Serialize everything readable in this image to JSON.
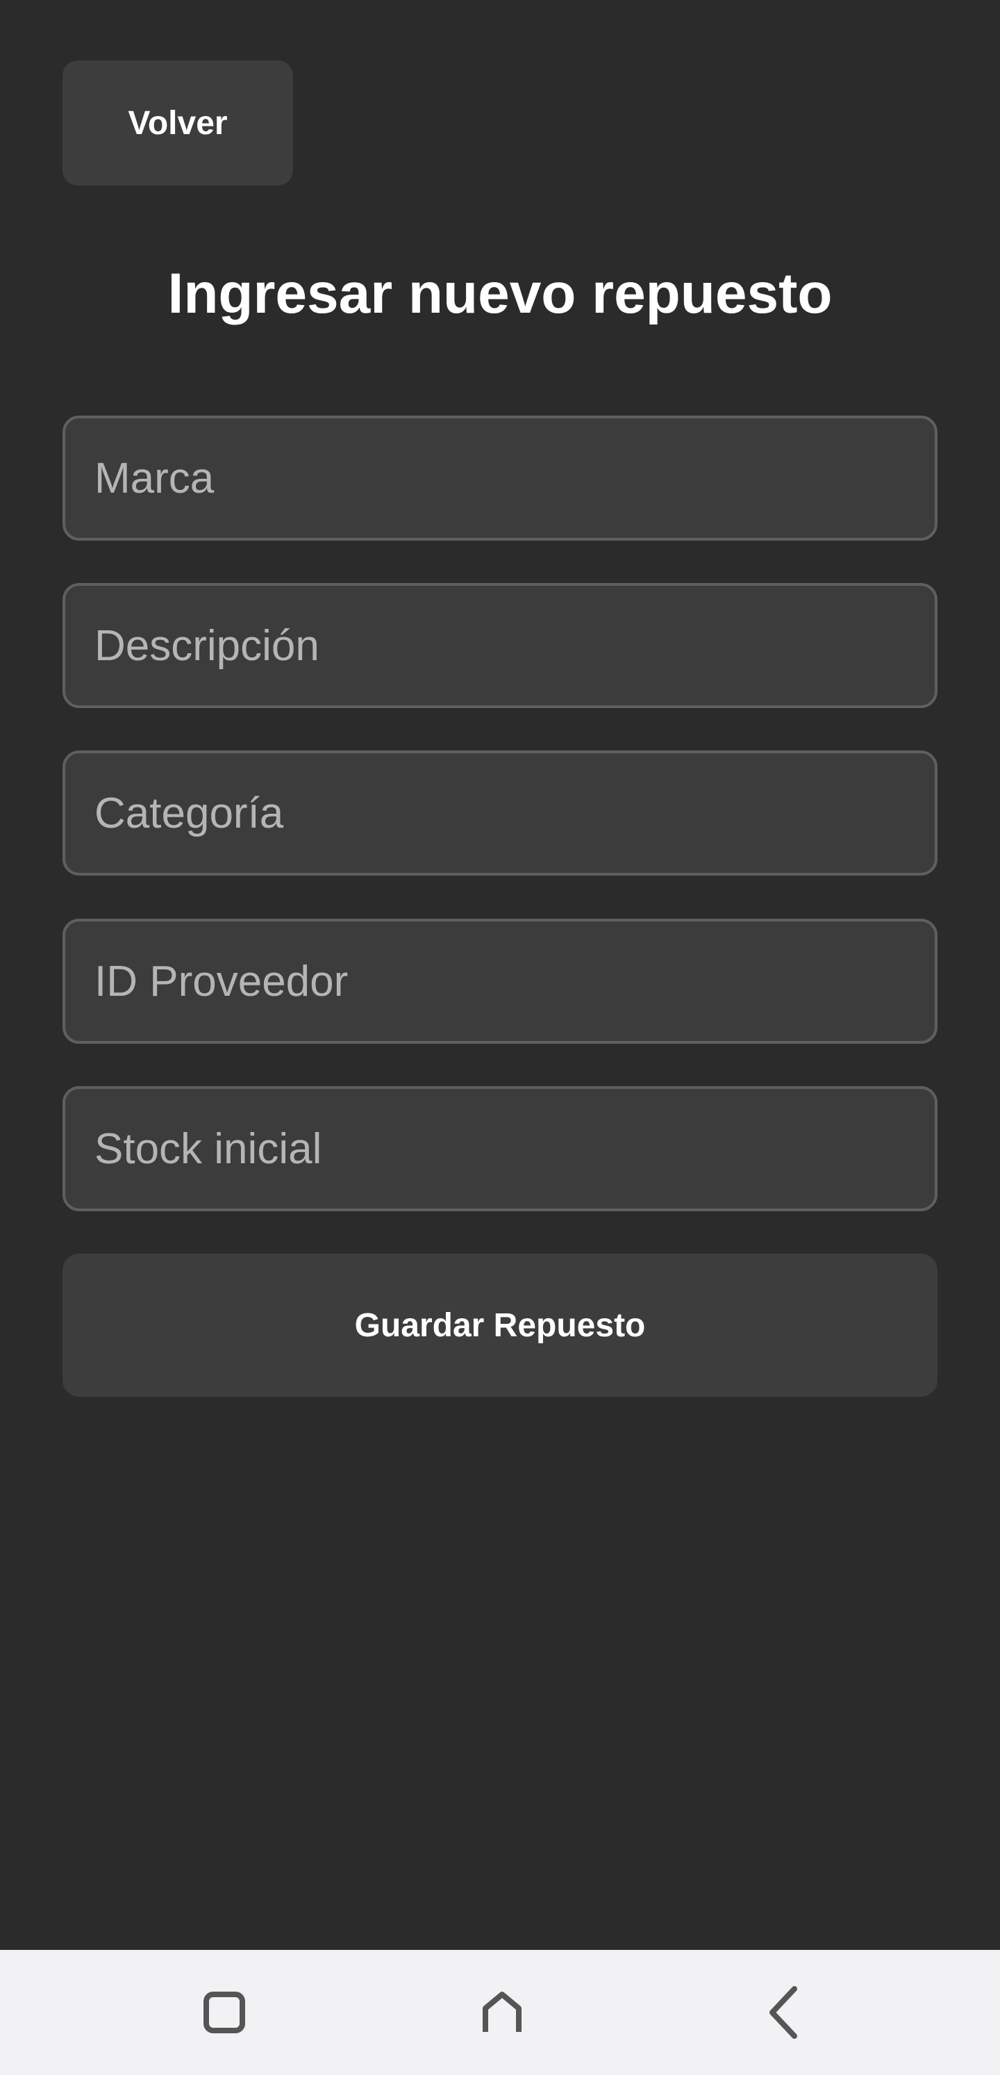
{
  "header": {
    "back_label": "Volver",
    "title": "Ingresar nuevo repuesto"
  },
  "form": {
    "fields": [
      {
        "placeholder": "Marca",
        "value": ""
      },
      {
        "placeholder": "Descripción",
        "value": ""
      },
      {
        "placeholder": "Categoría",
        "value": ""
      },
      {
        "placeholder": "ID Proveedor",
        "value": ""
      },
      {
        "placeholder": "Stock inicial",
        "value": ""
      }
    ],
    "submit_label": "Guardar Repuesto"
  },
  "nav": {
    "icons": [
      "recent-apps-icon",
      "home-icon",
      "back-icon"
    ]
  },
  "colors": {
    "background": "#2b2b2b",
    "surface": "#3d3d3d",
    "field_border": "#5f5f5f",
    "text": "#ffffff",
    "placeholder": "#b5b5b5",
    "nav_background": "#f2f2f4",
    "nav_icon": "#555555"
  }
}
